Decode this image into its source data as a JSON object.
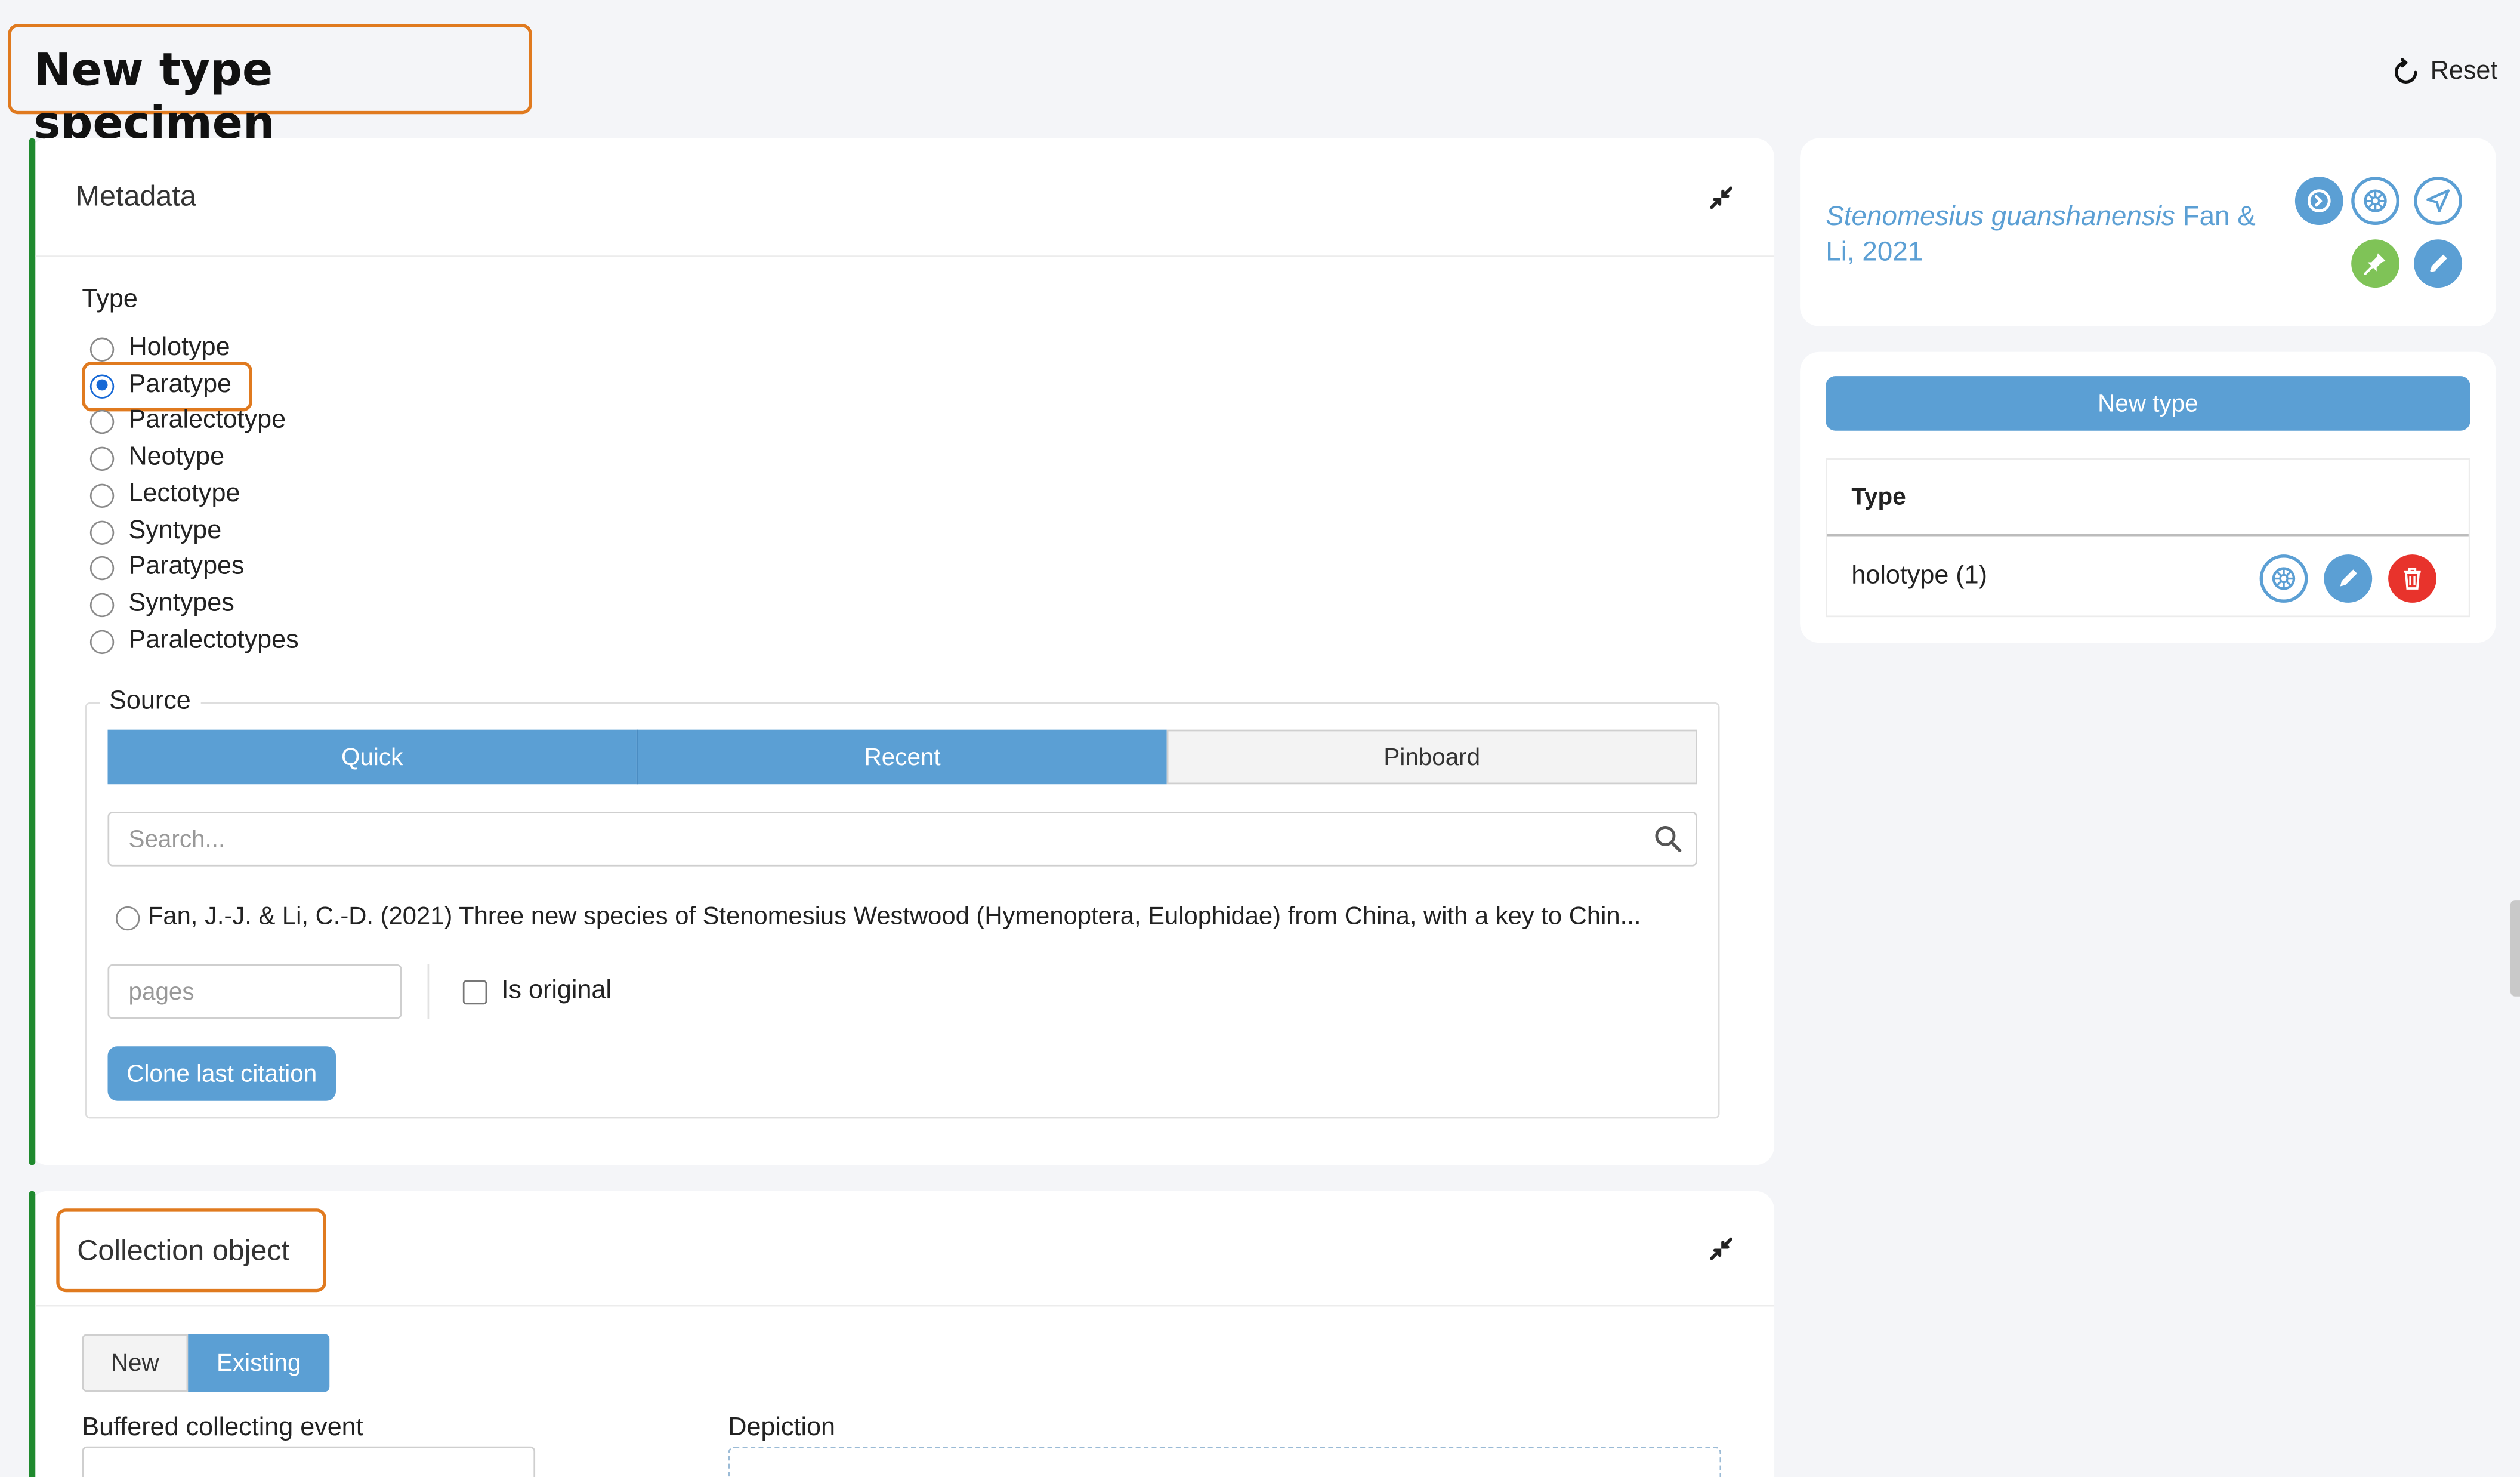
{
  "header": {
    "title": "New type specimen",
    "reset_label": "Reset"
  },
  "metadata": {
    "title": "Metadata",
    "type_label": "Type",
    "types": [
      "Holotype",
      "Paratype",
      "Paralectotype",
      "Neotype",
      "Lectotype",
      "Syntype",
      "Paratypes",
      "Syntypes",
      "Paralectotypes"
    ],
    "selected_type": "Paratype",
    "source": {
      "legend": "Source",
      "tabs": [
        "Quick",
        "Recent",
        "Pinboard"
      ],
      "active_tabs": [
        "Quick",
        "Recent"
      ],
      "search_placeholder": "Search...",
      "citation": "Fan, J.-J. & Li, C.-D. (2021) Three new species of Stenomesius Westwood (Hymenoptera, Eulophidae) from China, with a key to Chin...",
      "pages_placeholder": "pages",
      "is_original_label": "Is original",
      "clone_button": "Clone last citation"
    }
  },
  "collection_object": {
    "title": "Collection object",
    "toggle": [
      "New",
      "Existing"
    ],
    "active_toggle": "Existing",
    "buffered_label": "Buffered collecting event",
    "depiction_label": "Depiction"
  },
  "taxon": {
    "name_italic": "Stenomesius guanshanensis",
    "author_line1": "Fan &",
    "author_line2": "Li, 2021"
  },
  "types_panel": {
    "new_type_button": "New type",
    "column_header": "Type",
    "rows": [
      {
        "label": "holotype (1)"
      }
    ]
  },
  "colors": {
    "accent_blue": "#5b9fd4",
    "highlight_orange": "#e07a1f",
    "section_green": "#1f8a2e",
    "delete_red": "#e8332c",
    "pin_green": "#7fc357"
  }
}
